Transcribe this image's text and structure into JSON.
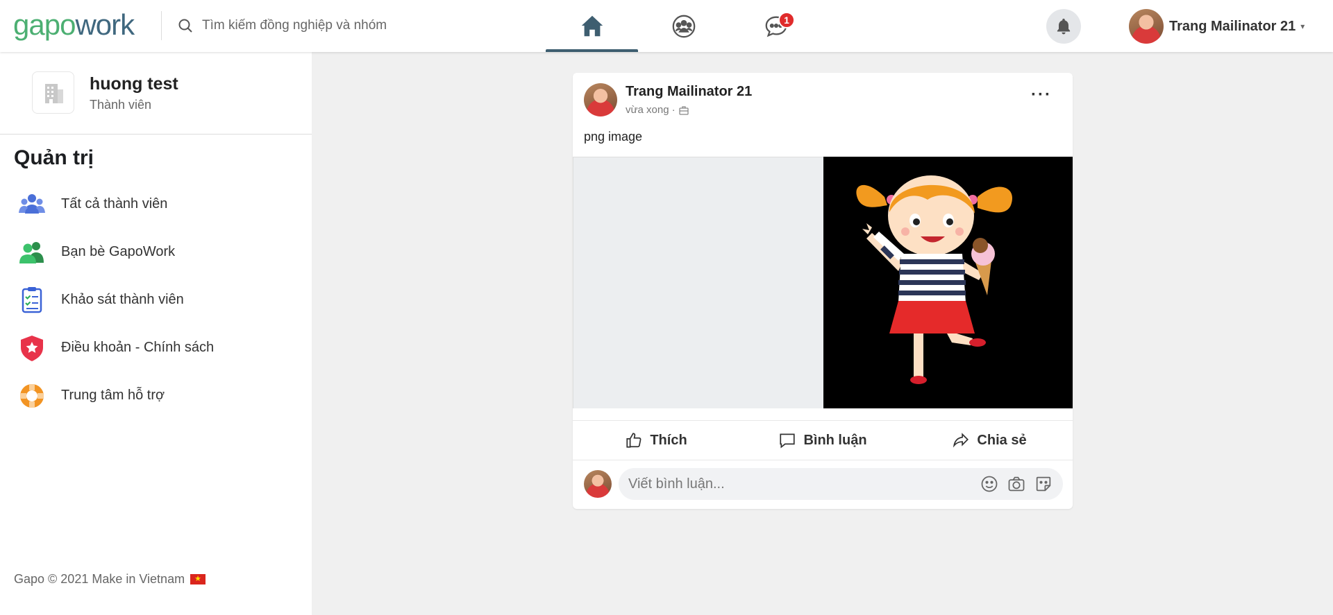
{
  "header": {
    "logo_part1": "gapo",
    "logo_part2": "work",
    "search_placeholder": "Tìm kiếm đồng nghiệp và nhóm",
    "nav": [
      {
        "name": "home",
        "icon": "home-icon",
        "active": true
      },
      {
        "name": "groups",
        "icon": "groups-icon",
        "active": false
      },
      {
        "name": "messages",
        "icon": "chat-icon",
        "active": false,
        "badge": "1"
      }
    ],
    "user_name": "Trang Mailinator 21",
    "caret": "▾"
  },
  "sidebar": {
    "org_name": "huong test",
    "org_role": "Thành viên",
    "section_title": "Quản trị",
    "items": [
      {
        "label": "Tất cả thành viên",
        "icon": "members-icon",
        "color": "#4a6fd8"
      },
      {
        "label": "Bạn bè GapoWork",
        "icon": "friends-icon",
        "color": "#2fae5d"
      },
      {
        "label": "Khảo sát thành viên",
        "icon": "survey-icon",
        "color": "#3a62d6"
      },
      {
        "label": "Điều khoản - Chính sách",
        "icon": "shield-star-icon",
        "color": "#e8334a"
      },
      {
        "label": "Trung tâm hỗ trợ",
        "icon": "lifebuoy-icon",
        "color": "#f29423"
      }
    ],
    "footer": "Gapo © 2021 Make in Vietnam",
    "flag": "★"
  },
  "post": {
    "author": "Trang Mailinator 21",
    "time": "vừa xong",
    "separator": "·",
    "text": "png image",
    "more": "···",
    "actions": {
      "like": "Thích",
      "comment": "Bình luận",
      "share": "Chia sẻ"
    },
    "comment_placeholder": "Viết bình luận..."
  },
  "colors": {
    "brand_green": "#4caf72",
    "brand_blue": "#40687f",
    "badge": "#e02b2b",
    "active_tab": "#3e5e70"
  }
}
